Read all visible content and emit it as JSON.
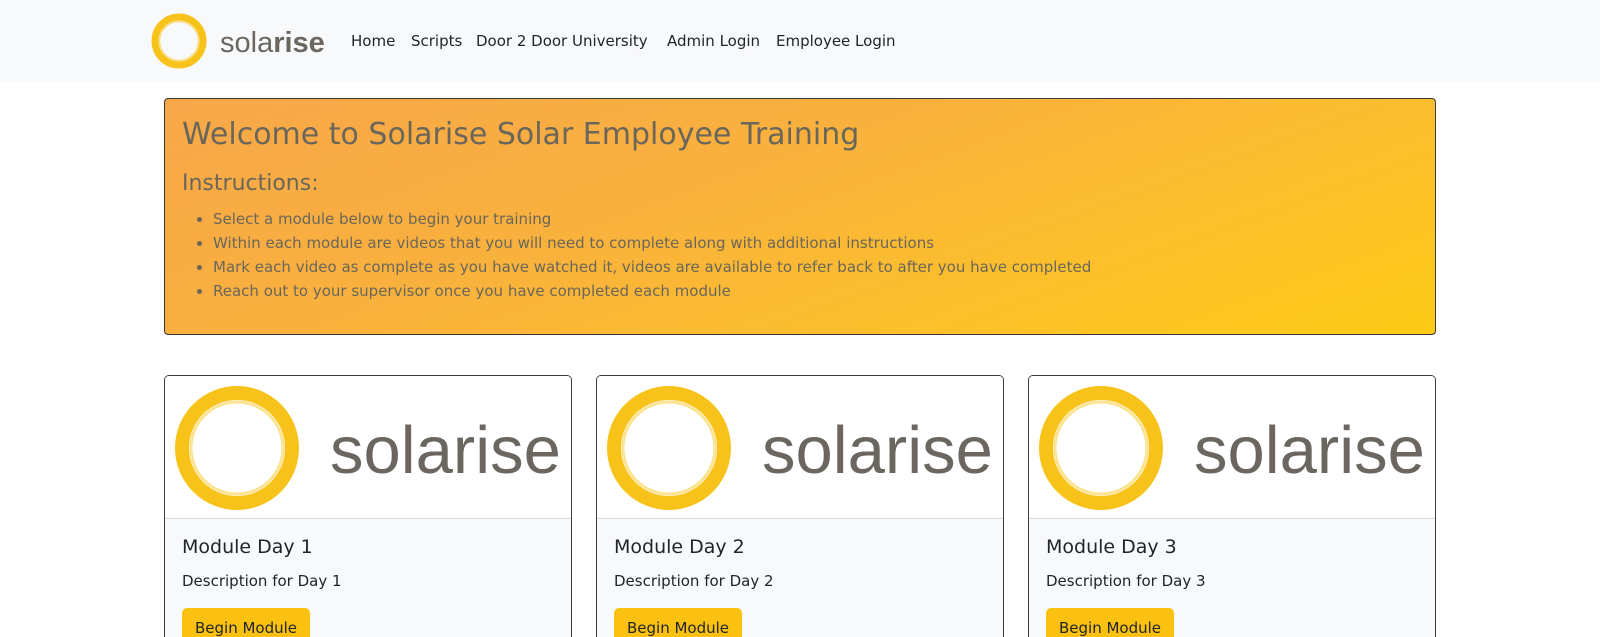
{
  "header": {
    "logo_text": "solarise",
    "nav": [
      "Home",
      "Scripts",
      "Door 2 Door University",
      "Admin Login",
      "Employee Login"
    ]
  },
  "hero": {
    "title": "Welcome to Solarise Solar Employee Training",
    "subtitle": "Instructions:",
    "instructions": [
      "Select a module below to begin your training",
      "Within each module are videos that you will need to complete along with additional instructions",
      "Mark each video as complete as you have watched it, videos are available to refer back to after you have completed",
      "Reach out to your supervisor once you have completed each module"
    ]
  },
  "modules": [
    {
      "image_text": "solarise",
      "title": "Module Day 1",
      "description": "Description for Day 1",
      "button": "Begin Module"
    },
    {
      "image_text": "solarise",
      "title": "Module Day 2",
      "description": "Description for Day 2",
      "button": "Begin Module"
    },
    {
      "image_text": "solarise",
      "title": "Module Day 3",
      "description": "Description for Day 3",
      "button": "Begin Module"
    }
  ],
  "colors": {
    "accent": "#fbc110",
    "logo_ring": "#f7c31a",
    "logo_text": "#6b6660",
    "hero_gradient_start": "#f7a74a",
    "hero_gradient_end": "#fdca15",
    "navbar_bg": "#f8f9fa"
  }
}
